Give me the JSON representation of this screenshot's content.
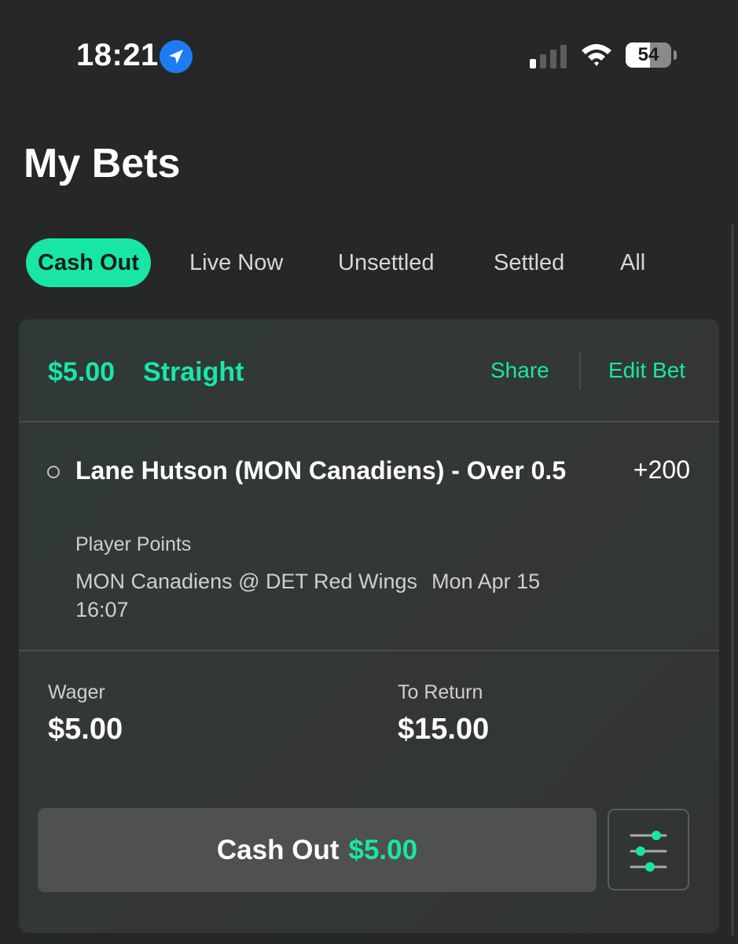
{
  "status_bar": {
    "time": "18:21",
    "battery_percent": "54",
    "battery_level": 0.54,
    "signal_bars_active": 1,
    "signal_bars_total": 4,
    "icons": [
      "location-arrow-icon",
      "cellular-signal-icon",
      "wifi-icon",
      "battery-icon"
    ]
  },
  "page": {
    "title": "My Bets"
  },
  "tabs": [
    {
      "label": "Cash Out",
      "active": true
    },
    {
      "label": "Live Now",
      "active": false
    },
    {
      "label": "Unsettled",
      "active": false
    },
    {
      "label": "Settled",
      "active": false
    },
    {
      "label": "All",
      "active": false
    }
  ],
  "bet": {
    "stake": "$5.00",
    "type": "Straight",
    "share_label": "Share",
    "edit_label": "Edit Bet",
    "selection": {
      "title": "Lane Hutson (MON Canadiens) - Over 0.5",
      "odds": "+200",
      "market": "Player Points",
      "event": "MON Canadiens @ DET Red Wings",
      "date": "Mon Apr 15 16:07"
    },
    "wager_label": "Wager",
    "wager_value": "$5.00",
    "return_label": "To Return",
    "return_value": "$15.00",
    "cashout_label": "Cash Out",
    "cashout_amount": "$5.00",
    "settings_icon": "sliders-icon"
  },
  "colors": {
    "accent": "#19e6a6",
    "background": "#262727",
    "card": "#333636",
    "button": "#4f5050",
    "location_blue": "#1f7bf2"
  }
}
